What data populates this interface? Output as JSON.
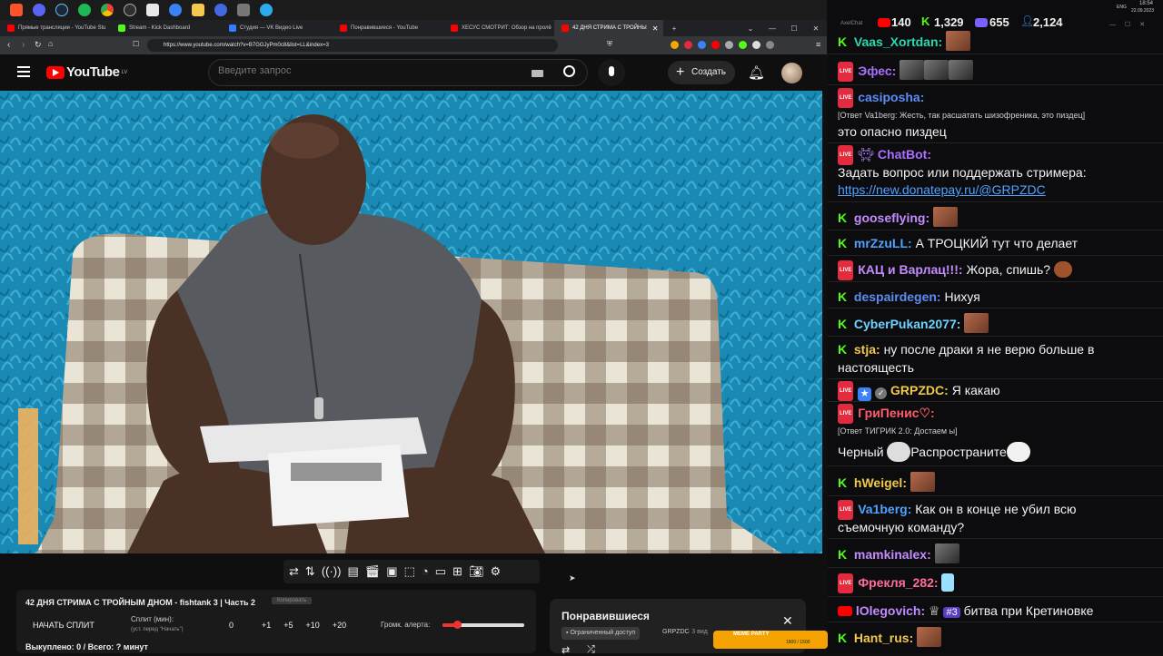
{
  "taskbar": {
    "icons": [
      "brave-icon",
      "discord-icon",
      "steam-icon",
      "spotify-icon",
      "chrome-icon",
      "obs-icon",
      "app-x-icon",
      "app-b-icon",
      "folder-icon",
      "app-p-icon",
      "app-c-icon",
      "telegram-icon"
    ],
    "clock_time": "18:54",
    "clock_date": "22.09.2023",
    "lang": "ENG"
  },
  "tabs": [
    {
      "label": "Прямые трансляции - YouTube Stu",
      "color": "#ff0000"
    },
    {
      "label": "Stream - Kick Dashboard",
      "color": "#53fc18"
    },
    {
      "label": "Студия — VK Видео Live",
      "color": "#2d81ff"
    },
    {
      "label": "Понравившиеся - YouTube",
      "color": "#ff0000"
    },
    {
      "label": "ХЕСУС СМОТРИТ: Обзор на пролё",
      "color": "#ff0000"
    },
    {
      "label": "42 ДНЯ СТРИМА С ТРОЙНЫ",
      "color": "#ff0000"
    }
  ],
  "address": {
    "url": "https://www.youtube.com/watch?v=B7GGJyPm0c8&list=LL&index=3"
  },
  "youtube": {
    "logo_text": "YouTube",
    "region": "LV",
    "search_placeholder": "Введите запрос",
    "create_label": "Создать"
  },
  "split": {
    "title": "42 ДНЯ СТРИМА С ТРОЙНЫМ ДНОМ - fishtank 3 | Часть 2",
    "copy_label": "Копировать",
    "start_label": "НАЧАТЬ СПЛИТ",
    "split_min_label": "Сплит (мин):",
    "split_hint": "(уст. перед \"Начать\")",
    "value": "0",
    "steps": [
      "+1",
      "+5",
      "+10",
      "+20"
    ],
    "volume_label": "Громк. алерта:",
    "volume_fraction": 0.18,
    "bought_label": "Выкуплено: 0 / Всего: ? минут"
  },
  "liked": {
    "title": "Понравившиеся",
    "access_label": "Ограниченный доступ",
    "owner": "GRPZDC",
    "meta": "· 3 вид",
    "meme_label": "MEME PARTY",
    "meme_progress": "1800 / 1500"
  },
  "chat": {
    "app_title": "AxelChat",
    "stats": [
      {
        "icon": "youtube-icon",
        "value": "140",
        "color": "#ff0000"
      },
      {
        "icon": "kick-icon",
        "value": "1,329",
        "color": "#53fc18"
      },
      {
        "icon": "vk-live-icon",
        "value": "655",
        "color": "#7b61ff"
      },
      {
        "icon": "viewers-icon",
        "value": "2,124",
        "color": "#3b9cff"
      }
    ],
    "messages": [
      {
        "platform": "kick",
        "nick": "Vaas_Xortdan",
        "color": "#29d9b0",
        "text": ""
      },
      {
        "platform": "vk",
        "nick": "Эфес",
        "color": "#a970ff",
        "text": ""
      },
      {
        "platform": "vk",
        "nick": "casiposha",
        "color": "#5b8df5",
        "reply": "[Ответ Va1berg: Жесть, так расшатать шизофреника, это пиздец]",
        "text": "это опасно пиздец"
      },
      {
        "platform": "vk",
        "nick": "ChatBot",
        "color": "#a970ff",
        "text": "Задать вопрос или поддержать стримера:",
        "link": "https://new.donatepay.ru/@GRPZDC"
      },
      {
        "platform": "kick",
        "nick": "gooseflying",
        "color": "#c48bff",
        "text": ""
      },
      {
        "platform": "kick",
        "nick": "mrZzuLL",
        "color": "#4fa3ff",
        "text": "А ТРОЦКИЙ тут что делает"
      },
      {
        "platform": "vk",
        "nick": "КАЦ и Варлац!!!",
        "color": "#c48bff",
        "text": "Жора, спишь?"
      },
      {
        "platform": "kick",
        "nick": "despairdegen",
        "color": "#5b8df5",
        "text": "Нихуя"
      },
      {
        "platform": "kick",
        "nick": "CyberPukan2077",
        "color": "#6fd3ff",
        "text": ""
      },
      {
        "platform": "kick",
        "nick": "stja",
        "color": "#f0c94b",
        "text": "ну после драки я не верю больше в",
        "text2": "настоящесть"
      },
      {
        "platform": "vk",
        "nick": "GRPZDC",
        "color": "#f0c94b",
        "text": "Я какаю"
      },
      {
        "platform": "vk",
        "nick": "ГриПенис",
        "color": "#ff5b6b",
        "reply": "[Ответ ТИГРИК 2.0: Достаем ы]",
        "text": "Черный",
        "text_b": "Распространите"
      },
      {
        "platform": "kick",
        "nick": "hWeigel",
        "color": "#f0c94b",
        "text": ""
      },
      {
        "platform": "vk",
        "nick": "Va1berg",
        "color": "#4fa3ff",
        "text": "Как он в конце не убил всю",
        "text2": "съемочную команду?"
      },
      {
        "platform": "kick",
        "nick": "mamkinalex",
        "color": "#c48bff",
        "text": ""
      },
      {
        "platform": "vk",
        "nick": "Фрекля_282",
        "color": "#ff6b9a",
        "text": ""
      },
      {
        "platform": "youtube",
        "nick": "lOlegovich",
        "color": "#c48bff",
        "badge": "#3",
        "text": "битва при Кретиновке"
      },
      {
        "platform": "kick",
        "nick": "Hant_rus",
        "color": "#f0c94b",
        "text": ""
      }
    ]
  }
}
